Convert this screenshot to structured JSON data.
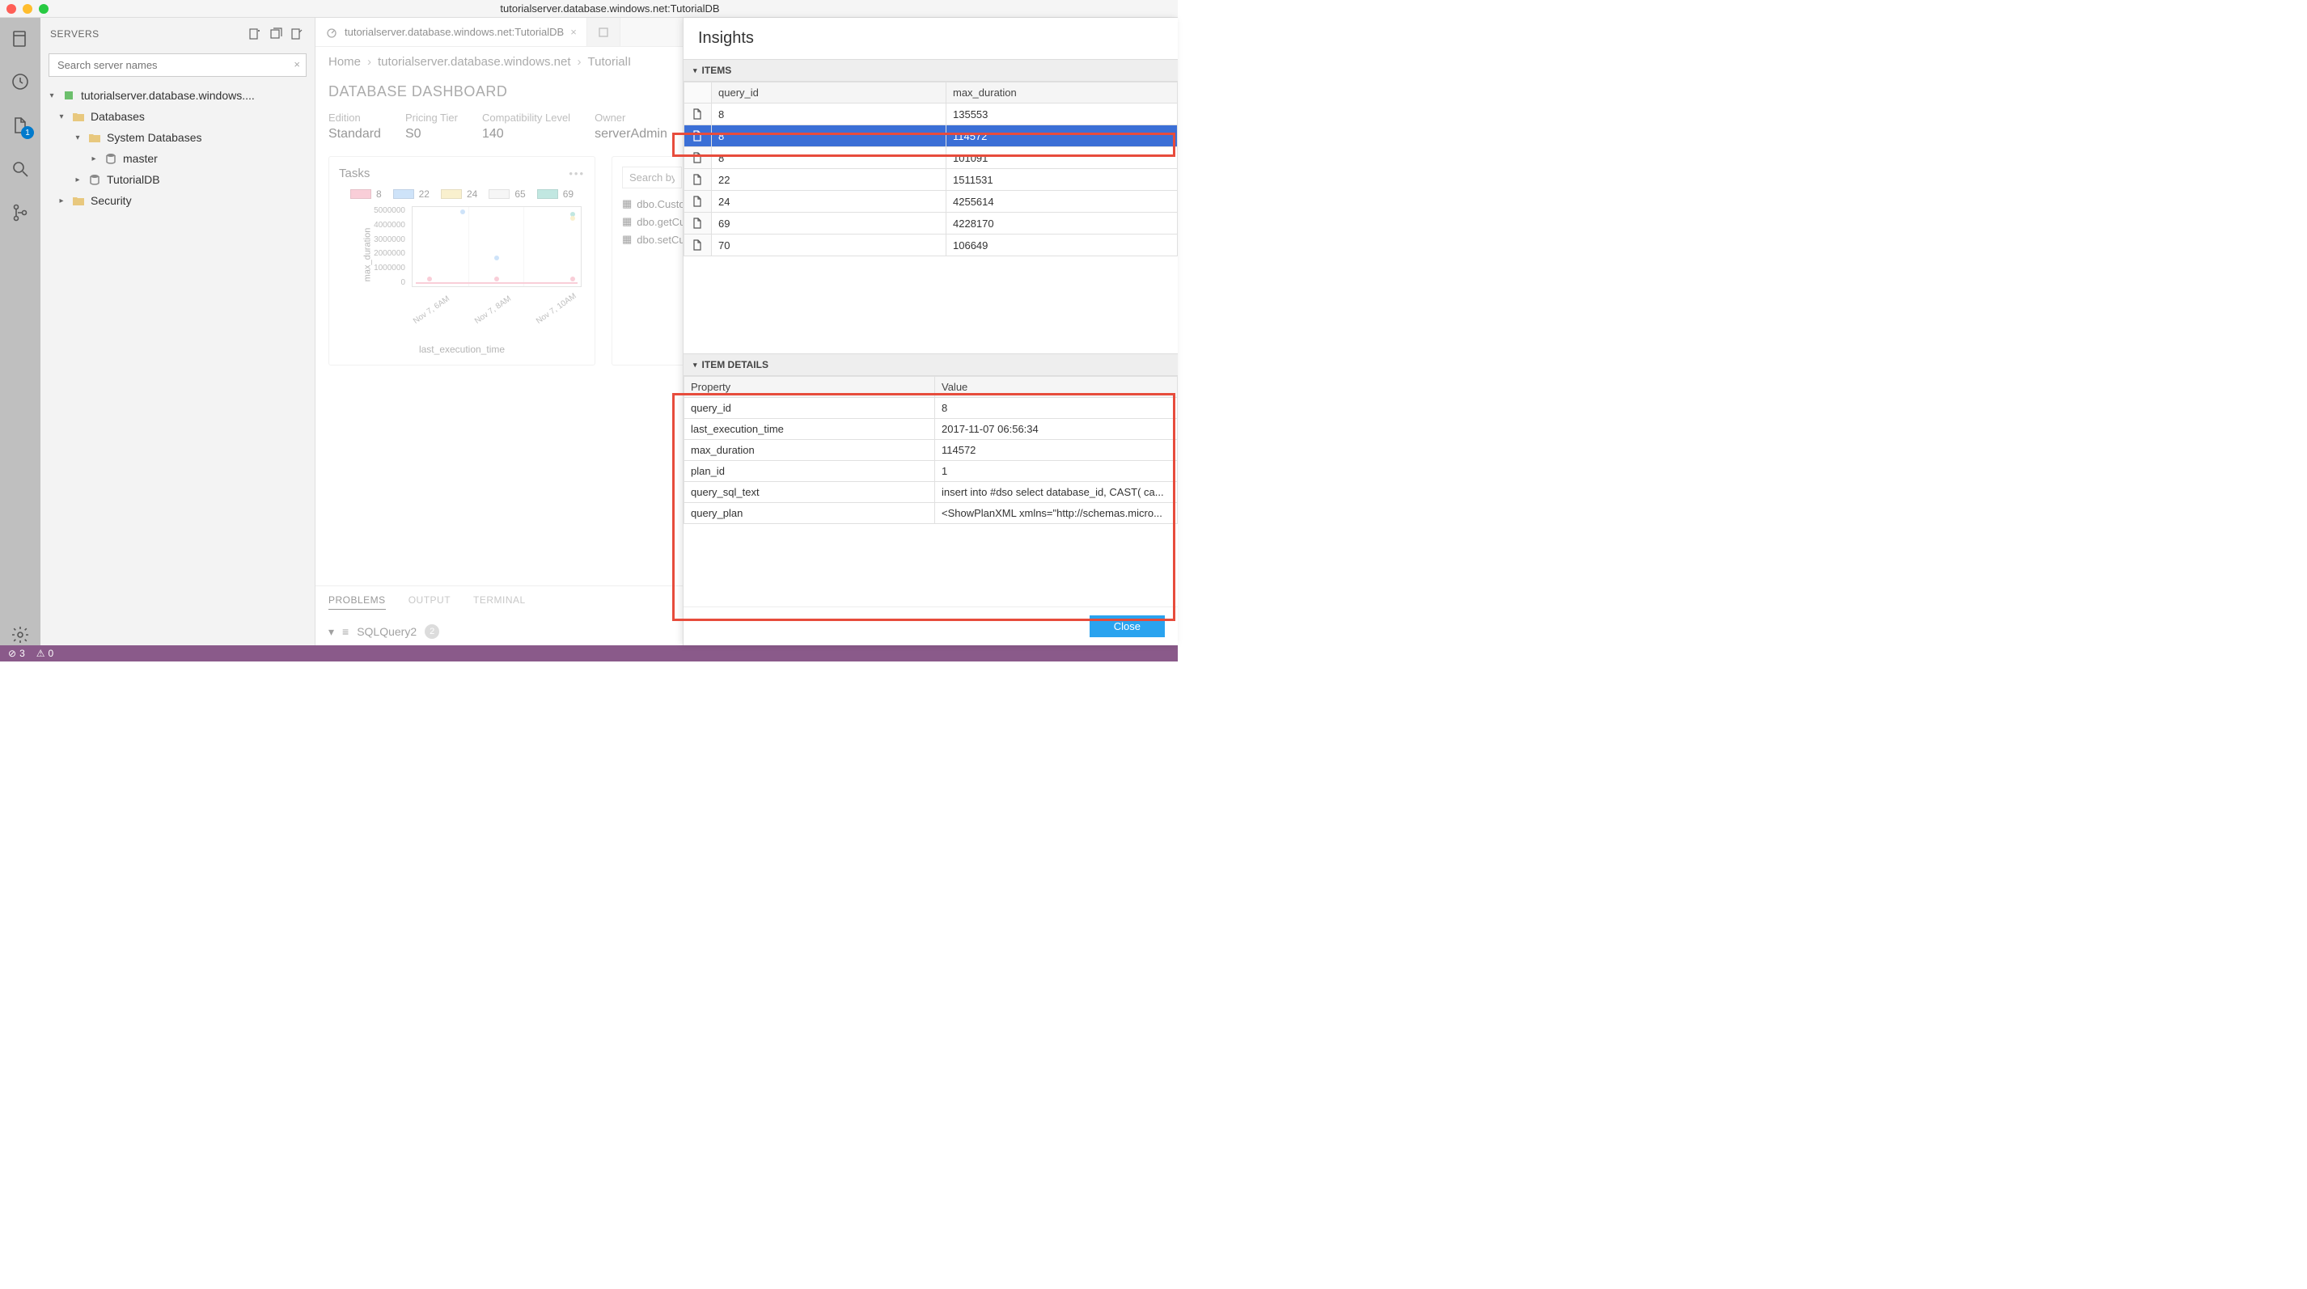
{
  "window": {
    "title": "tutorialserver.database.windows.net:TutorialDB"
  },
  "activitybar": {
    "files_badge": "1"
  },
  "sidebar": {
    "title": "SERVERS",
    "search_placeholder": "Search server names",
    "tree": {
      "server": "tutorialserver.database.windows....",
      "databases": "Databases",
      "system_databases": "System Databases",
      "master": "master",
      "tutorialdb": "TutorialDB",
      "security": "Security"
    }
  },
  "tabs": {
    "active": {
      "label": "tutorialserver.database.windows.net:TutorialDB"
    }
  },
  "breadcrumb": {
    "home": "Home",
    "server": "tutorialserver.database.windows.net",
    "db": "TutorialI"
  },
  "dashboard": {
    "title": "DATABASE DASHBOARD",
    "meta": [
      {
        "label": "Edition",
        "value": "Standard"
      },
      {
        "label": "Pricing Tier",
        "value": "S0"
      },
      {
        "label": "Compatibility Level",
        "value": "140"
      },
      {
        "label": "Owner",
        "value": "serverAdmin"
      }
    ],
    "tasks_title": "Tasks",
    "legend": [
      {
        "label": "8",
        "color": "#f4a7b9"
      },
      {
        "label": "22",
        "color": "#a7cdf4"
      },
      {
        "label": "24",
        "color": "#f4e3a7"
      },
      {
        "label": "65",
        "color": "#eeeeee"
      },
      {
        "label": "69",
        "color": "#8fd4c9"
      }
    ],
    "xlabel": "last_execution_time",
    "ylabel": "max_duration",
    "yaxis": [
      "5000000",
      "4000000",
      "3000000",
      "2000000",
      "1000000",
      "0"
    ],
    "xaxis": [
      "Nov 7, 6AM",
      "Nov 7, 8AM",
      "Nov 7, 10AM"
    ],
    "side_search_placeholder": "Search by na",
    "side_items": [
      "dbo.Custo",
      "dbo.getCu",
      "dbo.setCu"
    ]
  },
  "panel": {
    "tabs": {
      "problems": "PROBLEMS",
      "output": "OUTPUT",
      "terminal": "TERMINAL"
    },
    "item": "SQLQuery2",
    "count": "2"
  },
  "insights": {
    "title": "Insights",
    "items_header": "ITEMS",
    "columns": {
      "qid": "query_id",
      "maxd": "max_duration"
    },
    "rows": [
      {
        "qid": "8",
        "maxd": "135553"
      },
      {
        "qid": "8",
        "maxd": "114572",
        "selected": true
      },
      {
        "qid": "8",
        "maxd": "101091"
      },
      {
        "qid": "22",
        "maxd": "1511531"
      },
      {
        "qid": "24",
        "maxd": "4255614"
      },
      {
        "qid": "69",
        "maxd": "4228170"
      },
      {
        "qid": "70",
        "maxd": "106649"
      }
    ],
    "details_header": "ITEM DETAILS",
    "details_cols": {
      "prop": "Property",
      "val": "Value"
    },
    "details": [
      {
        "prop": "query_id",
        "val": "8"
      },
      {
        "prop": "last_execution_time",
        "val": "2017-11-07 06:56:34"
      },
      {
        "prop": "max_duration",
        "val": "114572"
      },
      {
        "prop": "plan_id",
        "val": "1"
      },
      {
        "prop": "query_sql_text",
        "val": "insert into #dso select database_id, CAST( ca..."
      },
      {
        "prop": "query_plan",
        "val": "<ShowPlanXML xmlns=\"http://schemas.micro..."
      }
    ],
    "close_btn": "Close"
  },
  "statusbar": {
    "errors": "3",
    "warnings": "0"
  },
  "chart_data": {
    "type": "scatter",
    "title": "Tasks",
    "xlabel": "last_execution_time",
    "ylabel": "max_duration",
    "ylim": [
      0,
      5000000
    ],
    "x_categories": [
      "Nov 7, 6AM",
      "Nov 7, 8AM",
      "Nov 7, 10AM"
    ],
    "series": [
      {
        "name": "8",
        "color": "#f4a7b9",
        "points": [
          {
            "x": "Nov 7, 6AM",
            "y": 150000
          },
          {
            "x": "Nov 7, 8AM",
            "y": 120000
          },
          {
            "x": "Nov 7, 10AM",
            "y": 110000
          }
        ]
      },
      {
        "name": "22",
        "color": "#a7cdf4",
        "points": [
          {
            "x": "Nov 7, 6AM",
            "y": 4500000
          },
          {
            "x": "Nov 7, 8AM",
            "y": 1500000
          }
        ]
      },
      {
        "name": "24",
        "color": "#f4e3a7",
        "points": [
          {
            "x": "Nov 7, 10AM",
            "y": 4300000
          }
        ]
      },
      {
        "name": "65",
        "color": "#eeeeee",
        "points": []
      },
      {
        "name": "69",
        "color": "#8fd4c9",
        "points": [
          {
            "x": "Nov 7, 10AM",
            "y": 4200000
          }
        ]
      }
    ]
  }
}
